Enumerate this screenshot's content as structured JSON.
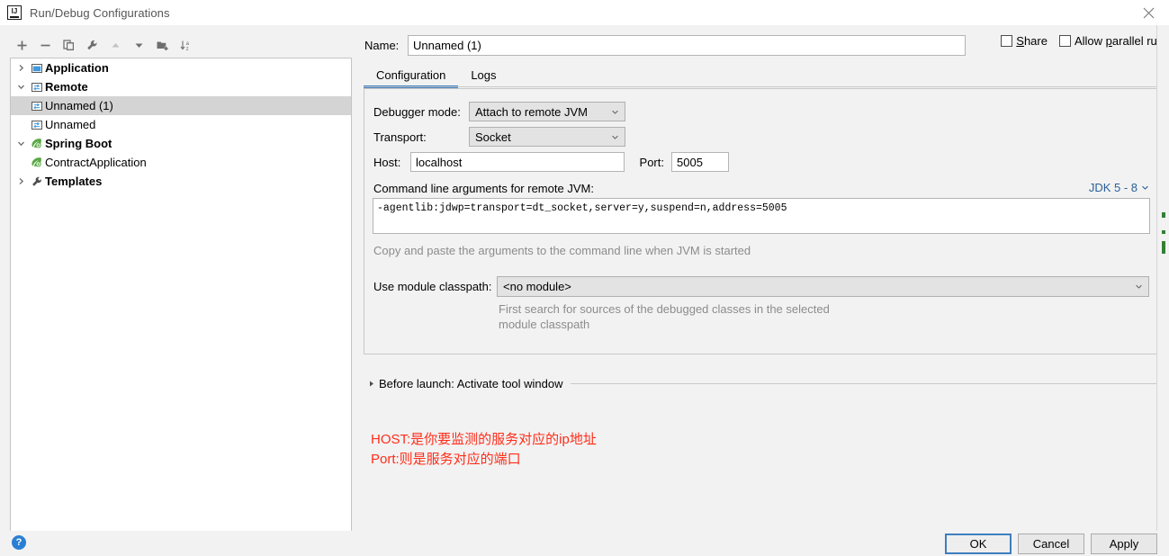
{
  "window": {
    "title": "Run/Debug Configurations",
    "app_icon": "intellij-idea-icon",
    "close_icon": "close-icon"
  },
  "toolbar": {
    "items": [
      {
        "name": "add-configuration-button",
        "icon": "plus-icon",
        "enabled": true
      },
      {
        "name": "remove-configuration-button",
        "icon": "minus-icon",
        "enabled": true
      },
      {
        "name": "copy-configuration-button",
        "icon": "copy-icon",
        "enabled": true
      },
      {
        "name": "edit-templates-button",
        "icon": "wrench-icon",
        "enabled": true
      },
      {
        "name": "move-up-button",
        "icon": "arrow-up-icon",
        "enabled": false
      },
      {
        "name": "move-down-button",
        "icon": "arrow-down-icon",
        "enabled": true
      },
      {
        "name": "create-folder-button",
        "icon": "folder-add-icon",
        "enabled": true
      },
      {
        "name": "sort-configurations-button",
        "icon": "sort-az-icon",
        "enabled": true
      }
    ]
  },
  "tree": {
    "nodes": [
      {
        "label": "Application",
        "icon": "application-icon",
        "expander": "chevron-right",
        "bold": true,
        "indent": 0,
        "selected": false
      },
      {
        "label": "Remote",
        "icon": "remote-icon",
        "expander": "chevron-down",
        "bold": true,
        "indent": 0,
        "selected": false
      },
      {
        "label": "Unnamed (1)",
        "icon": "remote-icon",
        "expander": "none",
        "bold": false,
        "indent": 1,
        "selected": true
      },
      {
        "label": "Unnamed",
        "icon": "remote-icon",
        "expander": "none",
        "bold": false,
        "indent": 1,
        "selected": false
      },
      {
        "label": "Spring Boot",
        "icon": "spring-boot-icon",
        "expander": "chevron-down",
        "bold": true,
        "indent": 0,
        "selected": false
      },
      {
        "label": "ContractApplication",
        "icon": "spring-boot-icon",
        "expander": "none",
        "bold": false,
        "indent": 1,
        "selected": false
      },
      {
        "label": "Templates",
        "icon": "wrench-icon",
        "expander": "chevron-right",
        "bold": true,
        "indent": 0,
        "selected": false
      }
    ]
  },
  "name_field": {
    "label": "Name:",
    "value": "Unnamed (1)",
    "placeholder": ""
  },
  "checkboxes": {
    "share": {
      "label": "Share",
      "checked": false
    },
    "allow_parallel_run": {
      "label": "Allow parallel run",
      "checked": false
    }
  },
  "tabs": [
    {
      "label": "Configuration",
      "active": true
    },
    {
      "label": "Logs",
      "active": false
    }
  ],
  "configuration": {
    "debugger_mode": {
      "label": "Debugger mode:",
      "value": "Attach to remote JVM"
    },
    "transport": {
      "label": "Transport:",
      "value": "Socket"
    },
    "host": {
      "label": "Host:",
      "value": "localhost"
    },
    "port": {
      "label": "Port:",
      "value": "5005"
    },
    "command_line": {
      "label": "Command line arguments for remote JVM:",
      "jdk_selector": "JDK 5 - 8",
      "value": "-agentlib:jdwp=transport=dt_socket,server=y,suspend=n,address=5005",
      "hint": "Copy and paste the arguments to the command line when JVM is started"
    },
    "module_classpath": {
      "label": "Use module classpath:",
      "value": "<no module>",
      "hint_line_1": "First search for sources of the debugged classes in the selected",
      "hint_line_2": "module classpath"
    }
  },
  "before_launch": {
    "label": "Before launch: Activate tool window",
    "expander": "triangle-right"
  },
  "annotation": {
    "line1": "HOST:是你要监测的服务对应的ip地址",
    "line2": "Port:则是服务对应的端口",
    "color": "#ff2d1a"
  },
  "footer": {
    "help_icon": "help-icon",
    "help_label": "?",
    "ok_label": "OK",
    "cancel_label": "Cancel",
    "apply_label": "Apply"
  },
  "colors": {
    "accent": "#3d7ec0",
    "link": "#2a6099",
    "selection": "#d4d4d4",
    "annotation": "#ff2d1a",
    "marker": "#338033"
  }
}
